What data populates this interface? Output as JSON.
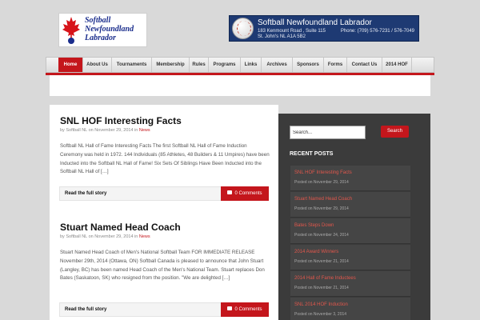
{
  "header": {
    "logo_lines": [
      "Softball",
      "Newfoundland",
      "Labrador"
    ],
    "banner": {
      "title": "Softball Newfoundland Labrador",
      "address_line1": "183 Kenmount Road , Suite 115",
      "address_line2": "St. John's NL A1A 5B2",
      "phone": "Phone: (709) 576-7231 / 576-7049"
    }
  },
  "nav": {
    "items": [
      "Home",
      "About Us",
      "Tournaments",
      "Membership",
      "Rules",
      "Programs",
      "Links",
      "Archives",
      "Sponsors",
      "Forms",
      "Contact Us",
      "2014 HOF"
    ],
    "active": "Home"
  },
  "posts": [
    {
      "title": "SNL HOF Interesting Facts",
      "meta_by": "by Softball NL on November 29, 2014 in",
      "category": "News",
      "excerpt": "Softball NL Hall of Fame Interesting Facts   The first Softball NL Hall of Fame Induction Ceremony was held in 1972.   144 Individuals (85 Athletes, 48 Builders & 11 Umpires) have been Inducted into the Softball NL Hall of Fame!   Six Sets Of Siblings Have Been Inducted into the Softball NL Hall of […]",
      "read_more": "Read the full story",
      "comments": "0 Comments"
    },
    {
      "title": "Stuart Named Head Coach",
      "meta_by": "by Softball NL on November 29, 2014 in",
      "category": "News",
      "excerpt": "Stuart Named Head Coach of Men's National Softball Team   FOR IMMEDIATE RELEASE November 29th, 2014   (Ottawa, ON) Softball Canada is pleased to announce that John Stuart (Langley, BC) has been named Head Coach of the Men's National Team. Stuart replaces Don Bates (Saskatoon, SK) who resigned from the position.   \"We are delighted […]",
      "read_more": "Read the full story",
      "comments": "0 Comments"
    }
  ],
  "sidebar": {
    "search_placeholder": "Search...",
    "search_button": "Search",
    "recent_heading": "RECENT POSTS",
    "recent_posts": [
      {
        "title": "SNL HOF Interesting Facts",
        "date": "Posted on November 29, 2014"
      },
      {
        "title": "Stuart Named Head Coach",
        "date": "Posted on November 29, 2014"
      },
      {
        "title": "Bates Steps Down",
        "date": "Posted on November 24, 2014"
      },
      {
        "title": "2014 Award Winners",
        "date": "Posted on November 21, 2014"
      },
      {
        "title": "2014 Hall of Fame Inductees",
        "date": "Posted on November 21, 2014"
      },
      {
        "title": "SNL 2014 HOF Induction",
        "date": "Posted on November 3, 2014"
      }
    ]
  },
  "colors": {
    "accent": "#c4161c",
    "page_bg": "#d9d9d9",
    "sidebar_bg": "#3b3b3b",
    "recent_link": "#e2574c",
    "banner_bg": "#1e3a73"
  }
}
